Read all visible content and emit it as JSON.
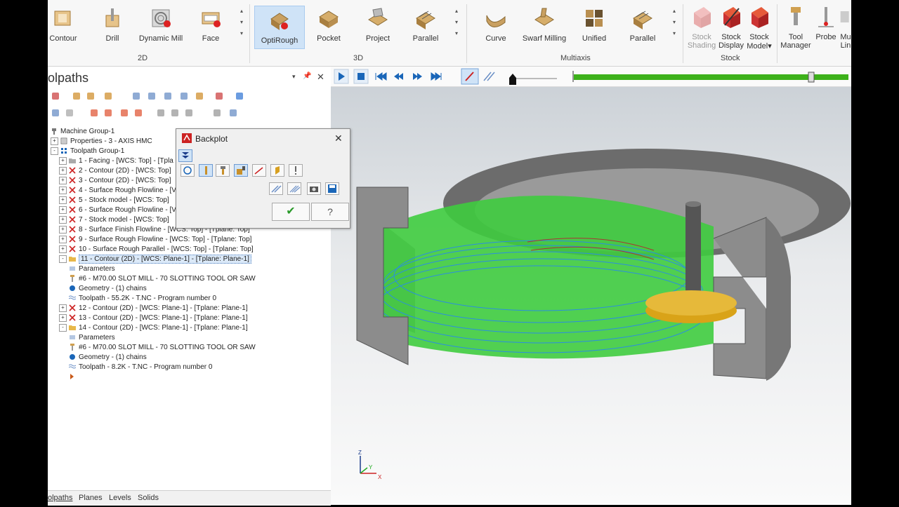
{
  "ribbon": {
    "groups": [
      {
        "label": "2D",
        "items": [
          "Contour",
          "Drill",
          "Dynamic Mill",
          "Face"
        ]
      },
      {
        "label": "3D",
        "items": [
          "OptiRough",
          "Pocket",
          "Project",
          "Parallel"
        ]
      },
      {
        "label": "Multiaxis",
        "items": [
          "Curve",
          "Swarf Milling",
          "Unified",
          "Parallel"
        ]
      },
      {
        "label": "Stock",
        "items": [
          "Stock\nShading",
          "Stock\nDisplay",
          "Stock\nModel"
        ]
      }
    ],
    "extra": [
      "Tool\nManager",
      "Probe",
      "Mu\nLin"
    ],
    "stock_shading_l1": "Stock",
    "stock_shading_l2": "Shading",
    "stock_display_l1": "Stock",
    "stock_display_l2": "Display",
    "stock_model_l1": "Stock",
    "stock_model_l2": "Model",
    "tool_manager_l1": "Tool",
    "tool_manager_l2": "Manager",
    "probe": "Probe",
    "mu_l1": "Mu",
    "mu_l2": "Lin",
    "dropdown_glyph": "▾"
  },
  "panel": {
    "title": "olpaths",
    "pin_glyph": "📌",
    "close_glyph": "✕",
    "dropdown_glyph": "▾"
  },
  "tree": [
    {
      "text": "Machine Group-1",
      "level": 0,
      "icon": "machine-icon"
    },
    {
      "text": "Properties - 3 - AXIS HMC",
      "level": 0,
      "exp": "+",
      "icon": "properties-icon"
    },
    {
      "text": "Toolpath Group-1",
      "level": 0,
      "exp": "-",
      "icon": "group-icon"
    },
    {
      "text": "1 - Facing - [WCS: Top] - [Tpla",
      "level": 1,
      "exp": "+",
      "icon": "folder-icon"
    },
    {
      "text": "2 - Contour (2D) - [WCS: Top]",
      "level": 1,
      "exp": "+",
      "icon": "x-icon"
    },
    {
      "text": "3 - Contour (2D) - [WCS: Top]",
      "level": 1,
      "exp": "+",
      "icon": "x-icon"
    },
    {
      "text": "4 - Surface Rough Flowline - [V",
      "level": 1,
      "exp": "+",
      "icon": "x-icon"
    },
    {
      "text": "5 - Stock model - [WCS: Top]",
      "level": 1,
      "exp": "+",
      "icon": "x-icon"
    },
    {
      "text": "6 - Surface Rough Flowline - [V",
      "level": 1,
      "exp": "+",
      "icon": "x-icon"
    },
    {
      "text": "7 - Stock model - [WCS: Top]",
      "level": 1,
      "exp": "+",
      "icon": "x-icon"
    },
    {
      "text": "8 - Surface Finish Flowline - [WCS: Top] - [Tplane: Top]",
      "level": 1,
      "exp": "+",
      "icon": "x-icon"
    },
    {
      "text": "9 - Surface Rough Flowline - [WCS: Top] - [Tplane: Top]",
      "level": 1,
      "exp": "+",
      "icon": "x-icon"
    },
    {
      "text": "10 - Surface Rough Parallel - [WCS: Top] - [Tplane: Top]",
      "level": 1,
      "exp": "+",
      "icon": "x-icon"
    },
    {
      "text": "11 - Contour (2D) - [WCS: Plane-1] - [Tplane: Plane-1]",
      "level": 1,
      "exp": "-",
      "icon": "open-folder-icon",
      "highlight": true
    },
    {
      "text": "Parameters",
      "level": 2,
      "icon": "parameters-icon"
    },
    {
      "text": "#6 - M70.00 SLOT MILL - 70 SLOTTING TOOL OR SAW",
      "level": 2,
      "icon": "tool-icon"
    },
    {
      "text": "Geometry - (1) chains",
      "level": 2,
      "icon": "geometry-icon"
    },
    {
      "text": "Toolpath - 55.2K - T.NC - Program number 0",
      "level": 2,
      "icon": "toolpath-icon"
    },
    {
      "text": "12 - Contour (2D) - [WCS: Plane-1] - [Tplane: Plane-1]",
      "level": 1,
      "exp": "+",
      "icon": "x-icon"
    },
    {
      "text": "13 - Contour (2D) - [WCS: Plane-1] - [Tplane: Plane-1]",
      "level": 1,
      "exp": "+",
      "icon": "x-icon"
    },
    {
      "text": "14 - Contour (2D) - [WCS: Plane-1] - [Tplane: Plane-1]",
      "level": 1,
      "exp": "-",
      "icon": "open-folder-icon"
    },
    {
      "text": "Parameters",
      "level": 2,
      "icon": "parameters-icon"
    },
    {
      "text": "#6 - M70.00 SLOT MILL - 70 SLOTTING TOOL OR SAW",
      "level": 2,
      "icon": "tool-icon"
    },
    {
      "text": "Geometry - (1) chains",
      "level": 2,
      "icon": "geometry-icon"
    },
    {
      "text": "Toolpath - 8.2K - T.NC - Program number 0",
      "level": 2,
      "icon": "toolpath-icon"
    },
    {
      "text": "",
      "level": 1,
      "icon": "insert-arrow-icon"
    }
  ],
  "bottom_tabs": [
    "olpaths",
    "Planes",
    "Levels",
    "Solids"
  ],
  "backplot": {
    "title": "Backplot",
    "close": "✕",
    "ok_glyph": "✔",
    "help_glyph": "?"
  },
  "axes": {
    "z": "Z",
    "y": "Y",
    "x": "X"
  },
  "colors": {
    "accent": "#1a78c2",
    "progress": "#3db11a",
    "part_green": "#3fd23f",
    "part_gray": "#8a8a8a",
    "toolpath_blue": "#2b8ee0",
    "tool_disk": "#e0b020"
  },
  "sim": {
    "progress": 0.99
  }
}
